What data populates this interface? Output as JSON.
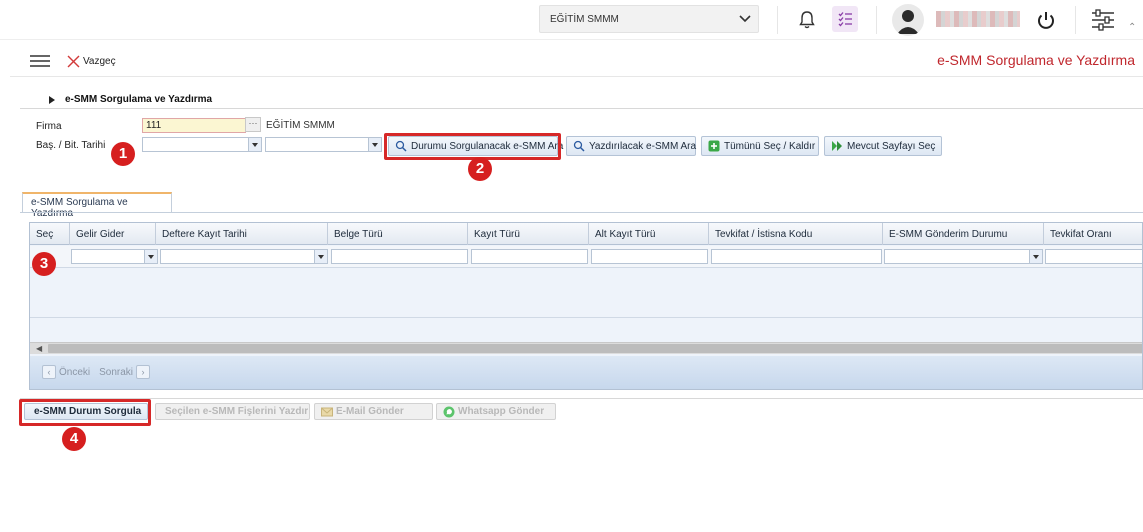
{
  "topbar": {
    "company": "EĞİTİM SMMM"
  },
  "toolbar": {
    "cancel_label": "Vazgeç",
    "page_title": "e-SMM Sorgulama ve Yazdırma"
  },
  "section": {
    "title": "e-SMM Sorgulama ve Yazdırma"
  },
  "form": {
    "firm_label": "Firma",
    "firm_value": "111",
    "firm_name": "EĞİTİM SMMM",
    "firm_picker_label": "···",
    "date_label": "Baş. / Bit. Tarihi"
  },
  "buttons": {
    "status_query_search": "Durumu Sorgulanacak e-SMM Ara",
    "printable_search": "Yazdırılacak e-SMM Ara",
    "select_all": "Tümünü Seç / Kaldır",
    "select_page": "Mevcut Sayfayı Seç"
  },
  "tab": {
    "label": "e-SMM Sorgulama ve Yazdırma"
  },
  "grid": {
    "columns": [
      "Seç",
      "Gelir Gider",
      "Deftere Kayıt Tarihi",
      "Belge Türü",
      "Kayıt Türü",
      "Alt Kayıt Türü",
      "Tevkifat / İstisna Kodu",
      "E-SMM Gönderim Durumu",
      "Tevkifat Oranı"
    ]
  },
  "pager": {
    "prev": "Önceki",
    "next": "Sonraki"
  },
  "bottom_buttons": {
    "status_query": "e-SMM Durum Sorgula",
    "print_selected": "Seçilen e-SMM Fişlerini Yazdır",
    "send_email": "E-Mail Gönder",
    "send_whatsapp": "Whatsapp Gönder"
  },
  "markers": [
    "1",
    "2",
    "3",
    "4"
  ],
  "colors": {
    "accent_red": "#c0272d",
    "marker_red": "#d61f1f",
    "grid_blue": "#c6d7ec"
  }
}
